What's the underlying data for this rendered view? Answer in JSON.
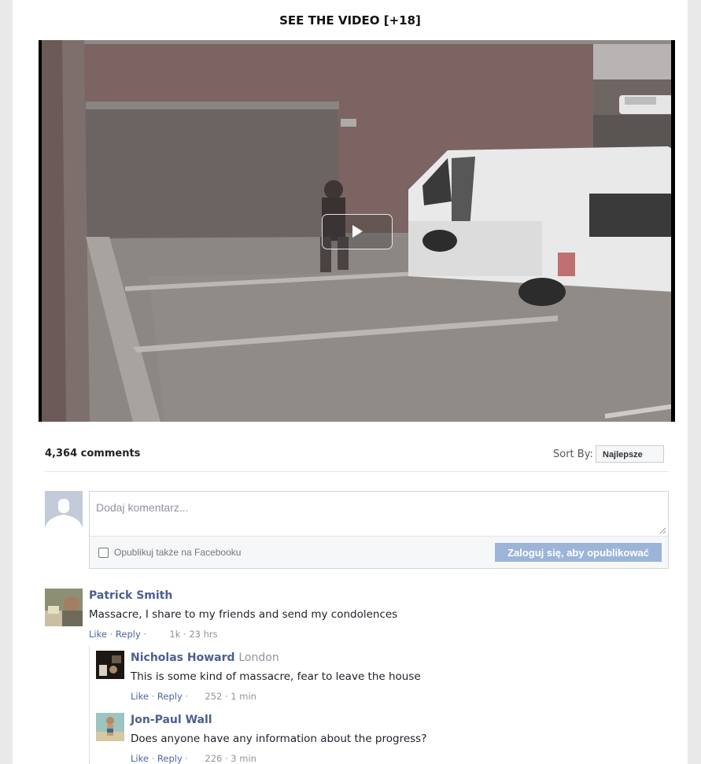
{
  "video": {
    "heading": "SEE THE VIDEO [+18]",
    "play_icon": "play-icon"
  },
  "comments_header": {
    "count": "4,364 comments",
    "sort_label": "Sort By:",
    "sort_value": "Najlepsze"
  },
  "composer": {
    "placeholder": "Dodaj komentarz...",
    "facebook_label": "Opublikuj także na Facebooku",
    "post_button": "Zaloguj się, aby opublikować"
  },
  "comments": [
    {
      "author": "Patrick Smith",
      "location": "",
      "text": "Massacre, I share to my friends and send my condolences",
      "like": "Like",
      "reply": "Reply",
      "sep": "·",
      "stats": "1k · 23 hrs"
    },
    {
      "author": "Nicholas Howard",
      "location": "London",
      "text": "This is some kind of massacre, fear to leave the house",
      "like": "Like",
      "reply": "Reply",
      "sep": "·",
      "stats": "252 · 1 min"
    },
    {
      "author": "Jon-Paul Wall",
      "location": "",
      "text": "Does anyone have any information about the progress?",
      "like": "Like",
      "reply": "Reply",
      "sep": "·",
      "stats": "226 · 3 min"
    }
  ],
  "colors": {
    "link": "#4b67a1",
    "author": "#4b5f8e",
    "button": "#9cb4d8",
    "muted": "#90949c"
  }
}
